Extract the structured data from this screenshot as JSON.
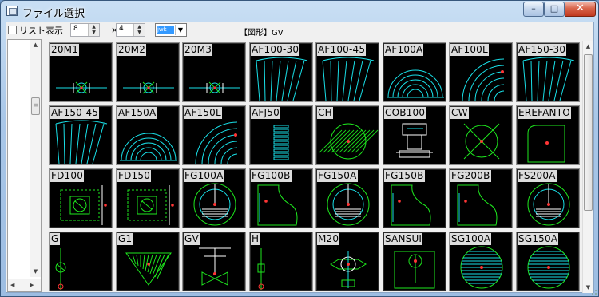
{
  "window": {
    "title": "ファイル選択",
    "buttons": {
      "minimize": "–",
      "maximize": "□",
      "close": "✕"
    }
  },
  "toolbar": {
    "list_label": "リスト表示",
    "cols": "8",
    "rows": "4",
    "times": "×",
    "file_type": "jwk",
    "folder": "【図形】GV"
  },
  "colors": {
    "tile_bg": "#000000",
    "cyan": "#19e0e8",
    "green": "#1ee81e",
    "red": "#ff3535",
    "white": "#ffffff"
  },
  "tiles": [
    {
      "label": "20M1",
      "icon": "pipe-fitting"
    },
    {
      "label": "20M2",
      "icon": "pipe-fitting"
    },
    {
      "label": "20M3",
      "icon": "pipe-fitting"
    },
    {
      "label": "AF100-30",
      "icon": "fan-arc"
    },
    {
      "label": "AF100-45",
      "icon": "fan-arc"
    },
    {
      "label": "AF100A",
      "icon": "semicircle-arcs"
    },
    {
      "label": "AF100L",
      "icon": "quarter-arcs"
    },
    {
      "label": "AF150-30",
      "icon": "fan-arc"
    },
    {
      "label": "AF150-45",
      "icon": "fan-arc"
    },
    {
      "label": "AF150A",
      "icon": "semicircle-arcs"
    },
    {
      "label": "AF150L",
      "icon": "quarter-arcs"
    },
    {
      "label": "AFJ50",
      "icon": "spring-stack"
    },
    {
      "label": "CH",
      "icon": "hatched-circle"
    },
    {
      "label": "COB100",
      "icon": "box-stack"
    },
    {
      "label": "CW",
      "icon": "circle-cross"
    },
    {
      "label": "EREFANTO",
      "icon": "elbow-shape"
    },
    {
      "label": "FD100",
      "icon": "damper-box"
    },
    {
      "label": "FD150",
      "icon": "damper-box"
    },
    {
      "label": "FG100A",
      "icon": "circle-lines"
    },
    {
      "label": "FG100B",
      "icon": "quarter-shape"
    },
    {
      "label": "FG150A",
      "icon": "circle-lines"
    },
    {
      "label": "FG150B",
      "icon": "quarter-shape"
    },
    {
      "label": "FG200B",
      "icon": "quarter-shape"
    },
    {
      "label": "FS200A",
      "icon": "circle-lines"
    },
    {
      "label": "G",
      "icon": "pole-valve"
    },
    {
      "label": "G1",
      "icon": "triangle-hatch"
    },
    {
      "label": "GV",
      "icon": "gate-valve"
    },
    {
      "label": "H",
      "icon": "hydrant"
    },
    {
      "label": "M20",
      "icon": "meter"
    },
    {
      "label": "SANSUI",
      "icon": "sprinkler-box"
    },
    {
      "label": "SG100A",
      "icon": "striped-circle"
    },
    {
      "label": "SG150A",
      "icon": "striped-circle"
    }
  ]
}
